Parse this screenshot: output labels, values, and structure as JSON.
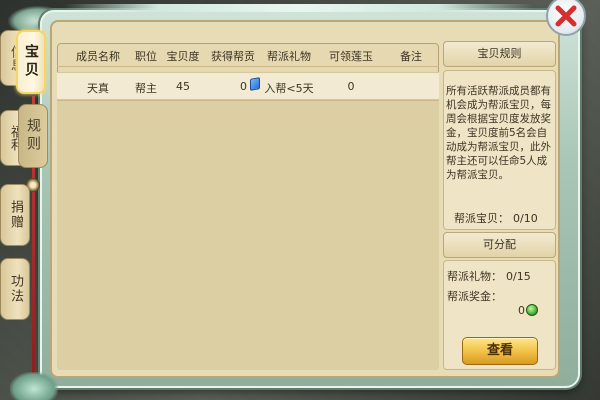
{
  "tabs": [
    {
      "label": "信息",
      "state": "side"
    },
    {
      "label": "宝贝",
      "state": "active"
    },
    {
      "label": "福利",
      "state": "side"
    },
    {
      "label": "规则",
      "state": "dim"
    },
    {
      "label": "捐赠",
      "state": "side"
    },
    {
      "label": "功法",
      "state": "side"
    }
  ],
  "table": {
    "headers": [
      "成员名称",
      "职位",
      "宝贝度",
      "获得帮贡",
      "帮派礼物",
      "可领莲玉",
      "备注"
    ],
    "rows": [
      {
        "name": "天真",
        "position": "帮主",
        "score": "45",
        "contribution": "0",
        "gift": "入帮<5天",
        "lotus": "0",
        "note": ""
      }
    ]
  },
  "rules": {
    "title": "宝贝规则",
    "text": "所有活跃帮派成员都有机会成为帮派宝贝，每周会根据宝贝度发放奖金，宝贝度前5名会自动成为帮派宝贝，此外帮主还可以任命5人成为帮派宝贝。",
    "count_label": "帮派宝贝：",
    "count_value": "0/10"
  },
  "allocation": {
    "title": "可分配",
    "gift_label": "帮派礼物：",
    "gift_value": "0/15",
    "money_label": "帮派奖金：",
    "money_value": "0"
  },
  "view_button": "查看",
  "icons": {
    "close": "close-icon",
    "contribution": "gem-icon",
    "money": "coin-icon"
  },
  "colors": {
    "close_x": "#d62f2f",
    "button_gold": "#f3c24a",
    "panel_parchment": "#e6d9b1"
  }
}
